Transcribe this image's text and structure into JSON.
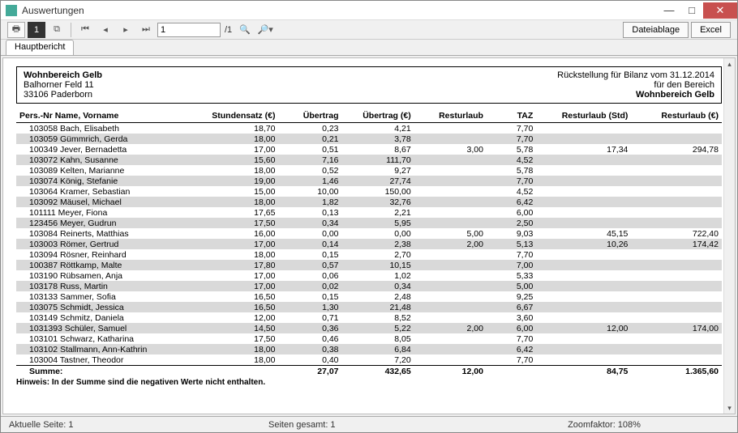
{
  "window": {
    "title": "Auswertungen"
  },
  "toolbar": {
    "page_input": "1",
    "page_total": "/1",
    "btn_dateiablage": "Dateiablage",
    "btn_excel": "Excel"
  },
  "tabs": {
    "main": "Hauptbericht"
  },
  "header": {
    "org": "Wohnbereich Gelb",
    "addr1": "Balhorner Feld 11",
    "addr2": "33106 Paderborn",
    "right1": "Rückstellung für Bilanz vom 31.12.2014",
    "right2": "für den Bereich",
    "right3": "Wohnbereich Gelb"
  },
  "columns": {
    "c0": "Pers.-Nr Name, Vorname",
    "c1": "Stundensatz (€)",
    "c2": "Übertrag",
    "c3": "Übertrag (€)",
    "c4": "Resturlaub",
    "c5": "TAZ",
    "c6": "Resturlaub (Std)",
    "c7": "Resturlaub  (€)"
  },
  "rows": [
    {
      "name": "103058 Bach, Elisabeth",
      "rate": "18,70",
      "ueb": "0,23",
      "uebE": "4,21",
      "rest": "",
      "taz": "7,70",
      "restStd": "",
      "restE": ""
    },
    {
      "name": "103059 Gümmrich, Gerda",
      "rate": "18,00",
      "ueb": "0,21",
      "uebE": "3,78",
      "rest": "",
      "taz": "7,70",
      "restStd": "",
      "restE": ""
    },
    {
      "name": "100349 Jever, Bernadetta",
      "rate": "17,00",
      "ueb": "0,51",
      "uebE": "8,67",
      "rest": "3,00",
      "taz": "5,78",
      "restStd": "17,34",
      "restE": "294,78"
    },
    {
      "name": "103072 Kahn, Susanne",
      "rate": "15,60",
      "ueb": "7,16",
      "uebE": "111,70",
      "rest": "",
      "taz": "4,52",
      "restStd": "",
      "restE": ""
    },
    {
      "name": "103089 Kelten, Marianne",
      "rate": "18,00",
      "ueb": "0,52",
      "uebE": "9,27",
      "rest": "",
      "taz": "5,78",
      "restStd": "",
      "restE": ""
    },
    {
      "name": "103074 König, Stefanie",
      "rate": "19,00",
      "ueb": "1,46",
      "uebE": "27,74",
      "rest": "",
      "taz": "7,70",
      "restStd": "",
      "restE": ""
    },
    {
      "name": "103064 Kramer, Sebastian",
      "rate": "15,00",
      "ueb": "10,00",
      "uebE": "150,00",
      "rest": "",
      "taz": "4,52",
      "restStd": "",
      "restE": ""
    },
    {
      "name": "103092 Mäusel, Michael",
      "rate": "18,00",
      "ueb": "1,82",
      "uebE": "32,76",
      "rest": "",
      "taz": "6,42",
      "restStd": "",
      "restE": ""
    },
    {
      "name": "101111 Meyer, Fiona",
      "rate": "17,65",
      "ueb": "0,13",
      "uebE": "2,21",
      "rest": "",
      "taz": "6,00",
      "restStd": "",
      "restE": ""
    },
    {
      "name": "123456 Meyer, Gudrun",
      "rate": "17,50",
      "ueb": "0,34",
      "uebE": "5,95",
      "rest": "",
      "taz": "2,50",
      "restStd": "",
      "restE": ""
    },
    {
      "name": "103084 Reinerts, Matthias",
      "rate": "16,00",
      "ueb": "0,00",
      "uebE": "0,00",
      "rest": "5,00",
      "taz": "9,03",
      "restStd": "45,15",
      "restE": "722,40"
    },
    {
      "name": "103003 Römer, Gertrud",
      "rate": "17,00",
      "ueb": "0,14",
      "uebE": "2,38",
      "rest": "2,00",
      "taz": "5,13",
      "restStd": "10,26",
      "restE": "174,42"
    },
    {
      "name": "103094 Rösner, Reinhard",
      "rate": "18,00",
      "ueb": "0,15",
      "uebE": "2,70",
      "rest": "",
      "taz": "7,70",
      "restStd": "",
      "restE": ""
    },
    {
      "name": "100387 Röttkamp, Malte",
      "rate": "17,80",
      "ueb": "0,57",
      "uebE": "10,15",
      "rest": "",
      "taz": "7,00",
      "restStd": "",
      "restE": ""
    },
    {
      "name": "103190 Rübsamen, Anja",
      "rate": "17,00",
      "ueb": "0,06",
      "uebE": "1,02",
      "rest": "",
      "taz": "5,33",
      "restStd": "",
      "restE": ""
    },
    {
      "name": "103178 Russ, Martin",
      "rate": "17,00",
      "ueb": "0,02",
      "uebE": "0,34",
      "rest": "",
      "taz": "5,00",
      "restStd": "",
      "restE": ""
    },
    {
      "name": "103133 Sammer, Sofia",
      "rate": "16,50",
      "ueb": "0,15",
      "uebE": "2,48",
      "rest": "",
      "taz": "9,25",
      "restStd": "",
      "restE": ""
    },
    {
      "name": "103075 Schmidt, Jessica",
      "rate": "16,50",
      "ueb": "1,30",
      "uebE": "21,48",
      "rest": "",
      "taz": "6,67",
      "restStd": "",
      "restE": ""
    },
    {
      "name": "103149 Schmitz, Daniela",
      "rate": "12,00",
      "ueb": "0,71",
      "uebE": "8,52",
      "rest": "",
      "taz": "3,60",
      "restStd": "",
      "restE": ""
    },
    {
      "name": "1031393 Schüler, Samuel",
      "rate": "14,50",
      "ueb": "0,36",
      "uebE": "5,22",
      "rest": "2,00",
      "taz": "6,00",
      "restStd": "12,00",
      "restE": "174,00"
    },
    {
      "name": "103101 Schwarz, Katharina",
      "rate": "17,50",
      "ueb": "0,46",
      "uebE": "8,05",
      "rest": "",
      "taz": "7,70",
      "restStd": "",
      "restE": ""
    },
    {
      "name": "103102 Stallmann, Ann-Kathrin",
      "rate": "18,00",
      "ueb": "0,38",
      "uebE": "6,84",
      "rest": "",
      "taz": "6,42",
      "restStd": "",
      "restE": ""
    },
    {
      "name": "103004 Tastner, Theodor",
      "rate": "18,00",
      "ueb": "0,40",
      "uebE": "7,20",
      "rest": "",
      "taz": "7,70",
      "restStd": "",
      "restE": ""
    }
  ],
  "sum": {
    "label": "Summe:",
    "ueb": "27,07",
    "uebE": "432,65",
    "rest": "12,00",
    "restStd": "84,75",
    "restE": "1.365,60"
  },
  "hint": "Hinweis: In der Summe sind die negativen Werte nicht enthalten.",
  "status": {
    "page": "Aktuelle Seite: 1",
    "total": "Seiten gesamt: 1",
    "zoom": "Zoomfaktor: 108%"
  }
}
